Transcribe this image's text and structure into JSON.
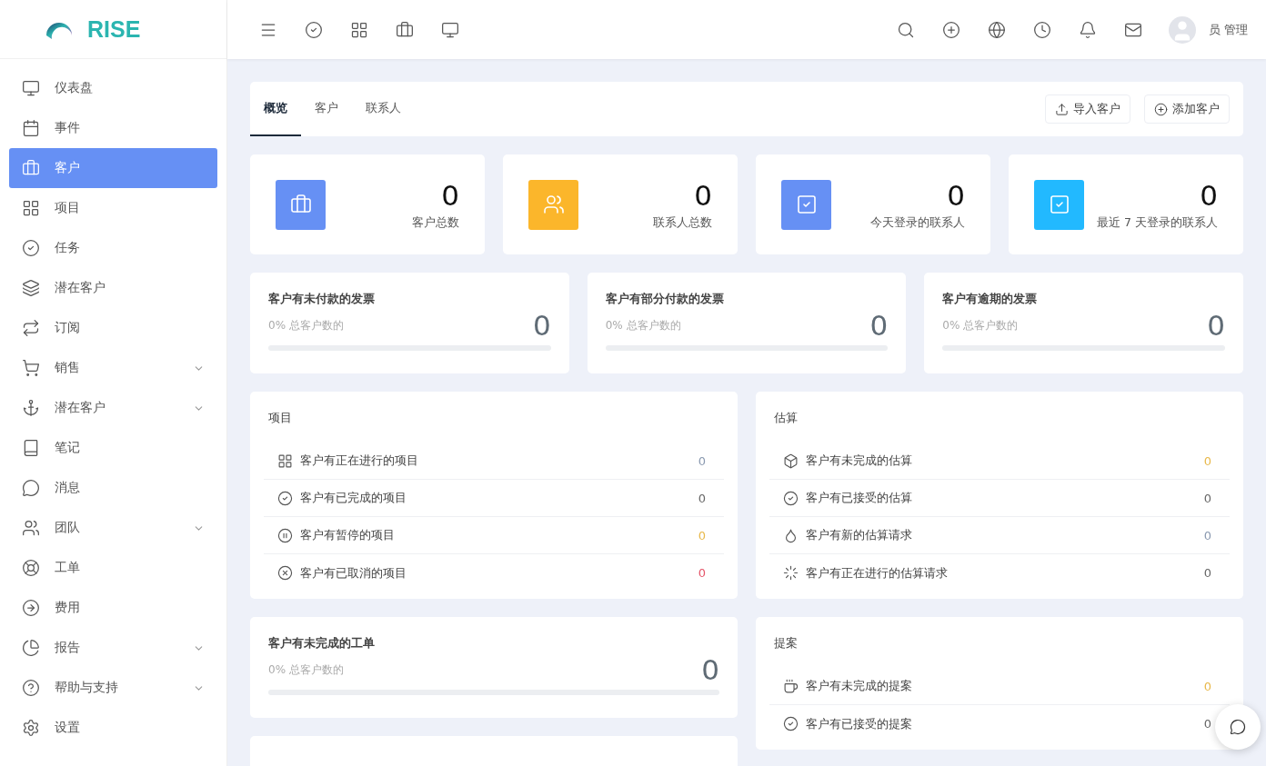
{
  "brand": {
    "name": "RISE"
  },
  "user": {
    "name": "员 管理"
  },
  "sidebar": {
    "items": [
      {
        "label": "仪表盘",
        "selected": false,
        "has_submenu": false
      },
      {
        "label": "事件",
        "selected": false,
        "has_submenu": false
      },
      {
        "label": "客户",
        "selected": true,
        "has_submenu": false
      },
      {
        "label": "项目",
        "selected": false,
        "has_submenu": false
      },
      {
        "label": "任务",
        "selected": false,
        "has_submenu": false
      },
      {
        "label": "潜在客户",
        "selected": false,
        "has_submenu": false
      },
      {
        "label": "订阅",
        "selected": false,
        "has_submenu": false
      },
      {
        "label": "销售",
        "selected": false,
        "has_submenu": true
      },
      {
        "label": "潜在客户",
        "selected": false,
        "has_submenu": true
      },
      {
        "label": "笔记",
        "selected": false,
        "has_submenu": false
      },
      {
        "label": "消息",
        "selected": false,
        "has_submenu": false
      },
      {
        "label": "团队",
        "selected": false,
        "has_submenu": true
      },
      {
        "label": "工单",
        "selected": false,
        "has_submenu": false
      },
      {
        "label": "费用",
        "selected": false,
        "has_submenu": false
      },
      {
        "label": "报告",
        "selected": false,
        "has_submenu": true
      },
      {
        "label": "帮助与支持",
        "selected": false,
        "has_submenu": true
      },
      {
        "label": "设置",
        "selected": false,
        "has_submenu": false
      }
    ]
  },
  "tabs": [
    {
      "label": "概览",
      "selected": true
    },
    {
      "label": "客户",
      "selected": false
    },
    {
      "label": "联系人",
      "selected": false
    }
  ],
  "actions": [
    {
      "label": "导入客户"
    },
    {
      "label": "添加客户"
    }
  ],
  "stat_cards": [
    {
      "value": "0",
      "label": "客户总数",
      "color": "#6690f4"
    },
    {
      "value": "0",
      "label": "联系人总数",
      "color": "#fbb62b"
    },
    {
      "value": "0",
      "label": "今天登录的联系人",
      "color": "#6690f4"
    },
    {
      "value": "0",
      "label": "最近 7 天登录的联系人",
      "color": "#22b9ff"
    }
  ],
  "invoice_cards": [
    {
      "title": "客户有未付款的发票",
      "caption": "0% 总客户数的",
      "value": "0"
    },
    {
      "title": "客户有部分付款的发票",
      "caption": "0% 总客户数的",
      "value": "0"
    },
    {
      "title": "客户有逾期的发票",
      "caption": "0% 总客户数的",
      "value": "0"
    }
  ],
  "projects": {
    "title": "项目",
    "rows": [
      {
        "label": "客户有正在进行的项目",
        "value": "0",
        "color": "#8a99b0"
      },
      {
        "label": "客户有已完成的项目",
        "value": "0",
        "color": "#666666"
      },
      {
        "label": "客户有暂停的项目",
        "value": "0",
        "color": "#e8b84a"
      },
      {
        "label": "客户有已取消的项目",
        "value": "0",
        "color": "#e5566a"
      }
    ]
  },
  "estimates": {
    "title": "估算",
    "rows": [
      {
        "label": "客户有未完成的估算",
        "value": "0",
        "color": "#e8b84a"
      },
      {
        "label": "客户有已接受的估算",
        "value": "0",
        "color": "#666666"
      },
      {
        "label": "客户有新的估算请求",
        "value": "0",
        "color": "#8a99b0"
      },
      {
        "label": "客户有正在进行的估算请求",
        "value": "0",
        "color": "#666666"
      }
    ]
  },
  "ticket_card": {
    "title": "客户有未完成的工单",
    "caption": "0% 总客户数的",
    "value": "0"
  },
  "proposals": {
    "title": "提案",
    "rows": [
      {
        "label": "客户有未完成的提案",
        "value": "0",
        "color": "#e8b84a"
      },
      {
        "label": "客户有已接受的提案",
        "value": "0",
        "color": "#666666"
      }
    ]
  }
}
